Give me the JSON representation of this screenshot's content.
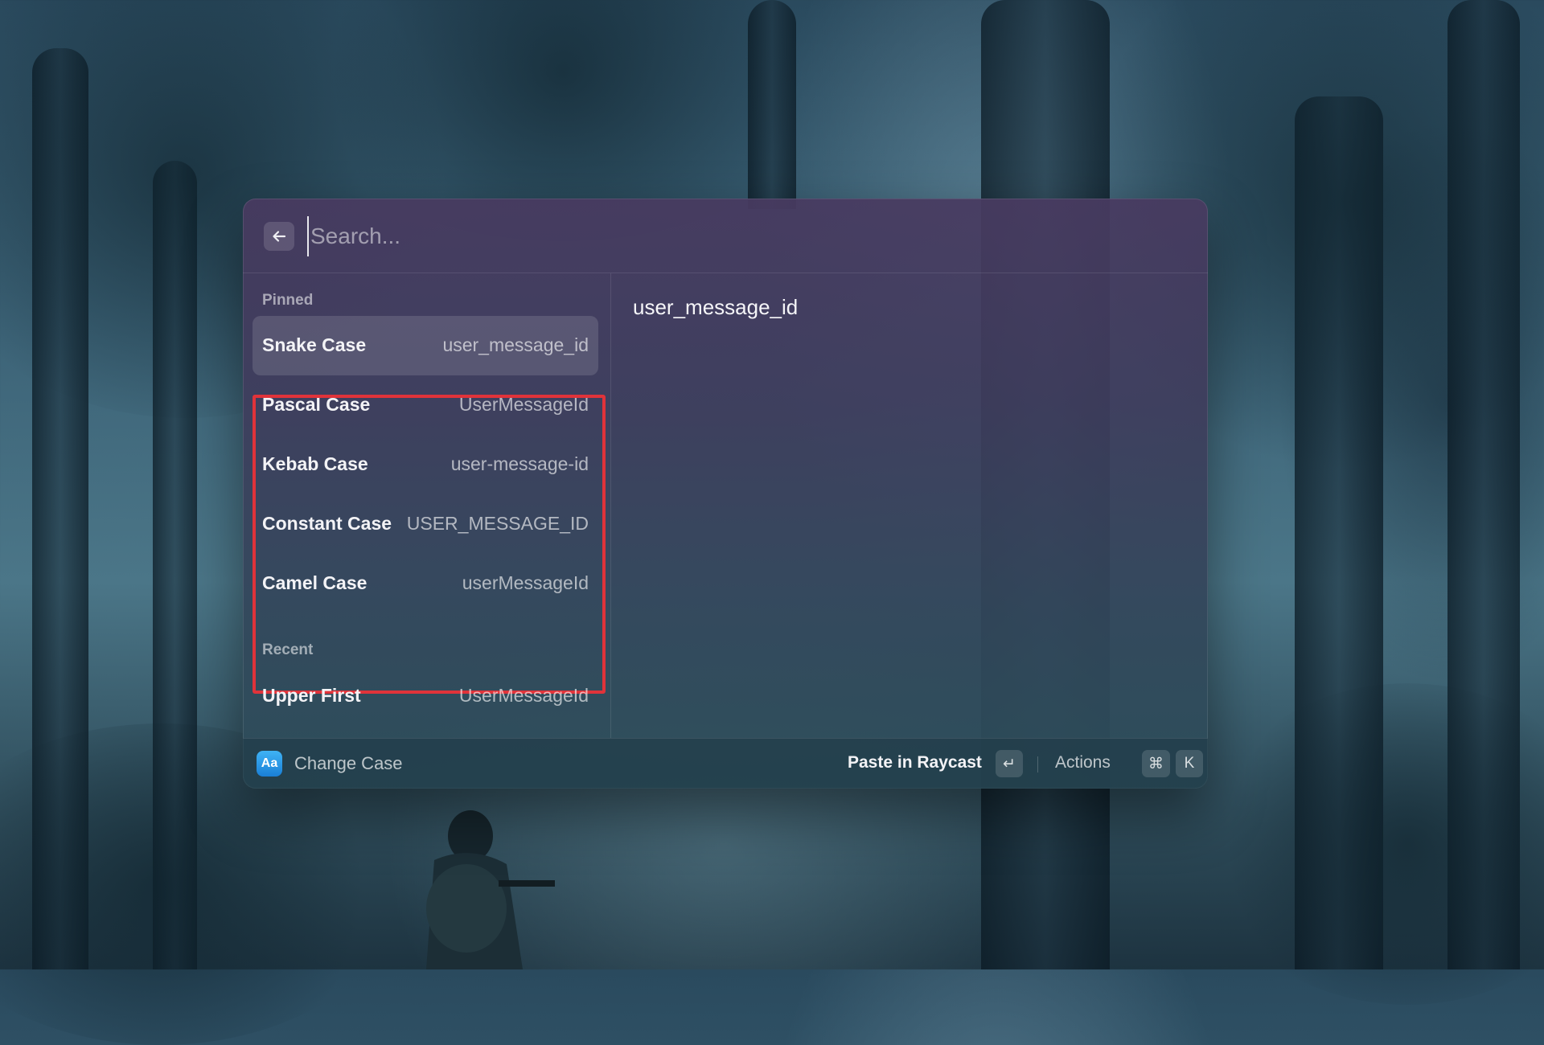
{
  "search": {
    "placeholder": "Search..."
  },
  "sections": {
    "pinned_label": "Pinned",
    "recent_label": "Recent"
  },
  "pinned_items": [
    {
      "title": "Snake Case",
      "value": "user_message_id"
    },
    {
      "title": "Pascal Case",
      "value": "UserMessageId"
    },
    {
      "title": "Kebab Case",
      "value": "user-message-id"
    },
    {
      "title": "Constant Case",
      "value": "USER_MESSAGE_ID"
    },
    {
      "title": "Camel Case",
      "value": "userMessageId"
    }
  ],
  "recent_items": [
    {
      "title": "Upper First",
      "value": "UserMessageId"
    }
  ],
  "detail": {
    "text": "user_message_id"
  },
  "action_bar": {
    "extension_icon_text": "Aa",
    "extension_name": "Change Case",
    "primary_action": "Paste in Raycast",
    "primary_key": "↵",
    "actions_label": "Actions",
    "actions_keys": [
      "⌘",
      "K"
    ]
  },
  "colors": {
    "highlight": "#e0333a",
    "extension_icon": "#2a95e6"
  }
}
